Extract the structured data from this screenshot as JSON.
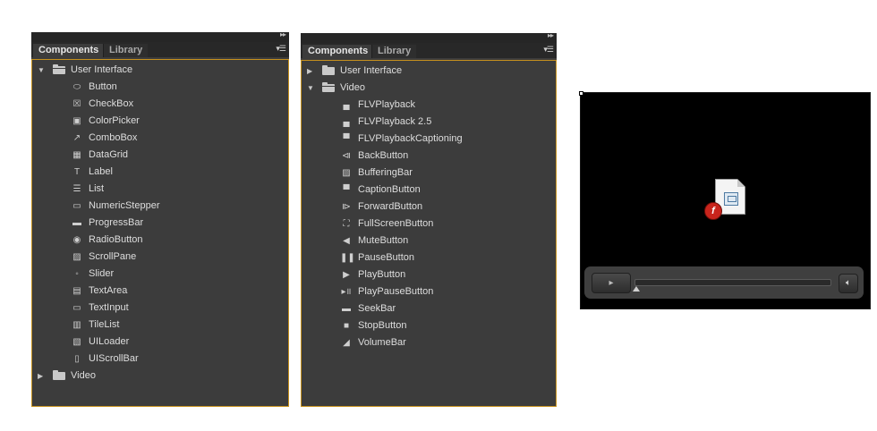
{
  "panel1": {
    "tabs": [
      "Components",
      "Library"
    ],
    "items": [
      {
        "kind": "folder",
        "open": true,
        "label": "User Interface"
      },
      {
        "kind": "item",
        "icon": "button-icon",
        "glyph": "⬭",
        "label": "Button"
      },
      {
        "kind": "item",
        "icon": "checkbox-icon",
        "glyph": "☒",
        "label": "CheckBox"
      },
      {
        "kind": "item",
        "icon": "colorpicker-icon",
        "glyph": "▣",
        "label": "ColorPicker"
      },
      {
        "kind": "item",
        "icon": "combobox-icon",
        "glyph": "↗",
        "label": "ComboBox"
      },
      {
        "kind": "item",
        "icon": "datagrid-icon",
        "glyph": "▦",
        "label": "DataGrid"
      },
      {
        "kind": "item",
        "icon": "label-icon",
        "glyph": "T",
        "label": "Label"
      },
      {
        "kind": "item",
        "icon": "list-icon",
        "glyph": "☰",
        "label": "List"
      },
      {
        "kind": "item",
        "icon": "numericstepper-icon",
        "glyph": "▭",
        "label": "NumericStepper"
      },
      {
        "kind": "item",
        "icon": "progressbar-icon",
        "glyph": "▬",
        "label": "ProgressBar"
      },
      {
        "kind": "item",
        "icon": "radiobutton-icon",
        "glyph": "◉",
        "label": "RadioButton"
      },
      {
        "kind": "item",
        "icon": "scrollpane-icon",
        "glyph": "▨",
        "label": "ScrollPane"
      },
      {
        "kind": "item",
        "icon": "slider-icon",
        "glyph": "◦",
        "label": "Slider"
      },
      {
        "kind": "item",
        "icon": "textarea-icon",
        "glyph": "▤",
        "label": "TextArea"
      },
      {
        "kind": "item",
        "icon": "textinput-icon",
        "glyph": "▭",
        "label": "TextInput"
      },
      {
        "kind": "item",
        "icon": "tilelist-icon",
        "glyph": "▥",
        "label": "TileList"
      },
      {
        "kind": "item",
        "icon": "uiloader-icon",
        "glyph": "▧",
        "label": "UILoader"
      },
      {
        "kind": "item",
        "icon": "uiscrollbar-icon",
        "glyph": "▯",
        "label": "UIScrollBar"
      },
      {
        "kind": "folder",
        "open": false,
        "label": "Video"
      }
    ]
  },
  "panel2": {
    "tabs": [
      "Components",
      "Library"
    ],
    "items": [
      {
        "kind": "folder",
        "open": false,
        "label": "User Interface"
      },
      {
        "kind": "folder",
        "open": true,
        "label": "Video"
      },
      {
        "kind": "item",
        "icon": "flvplayback-icon",
        "glyph": "▄",
        "label": "FLVPlayback"
      },
      {
        "kind": "item",
        "icon": "flvplayback25-icon",
        "glyph": "▄",
        "label": "FLVPlayback 2.5"
      },
      {
        "kind": "item",
        "icon": "flvplaybackcaptioning-icon",
        "glyph": "▀",
        "label": "FLVPlaybackCaptioning"
      },
      {
        "kind": "item",
        "icon": "backbutton-icon",
        "glyph": "⧏",
        "label": "BackButton"
      },
      {
        "kind": "item",
        "icon": "bufferingbar-icon",
        "glyph": "▨",
        "label": "BufferingBar"
      },
      {
        "kind": "item",
        "icon": "captionbutton-icon",
        "glyph": "▀",
        "label": "CaptionButton"
      },
      {
        "kind": "item",
        "icon": "forwardbutton-icon",
        "glyph": "⧐",
        "label": "ForwardButton"
      },
      {
        "kind": "item",
        "icon": "fullscreenbutton-icon",
        "glyph": "⛶",
        "label": "FullScreenButton"
      },
      {
        "kind": "item",
        "icon": "mutebutton-icon",
        "glyph": "◀",
        "label": "MuteButton"
      },
      {
        "kind": "item",
        "icon": "pausebutton-icon",
        "glyph": "❚❚",
        "label": "PauseButton"
      },
      {
        "kind": "item",
        "icon": "playbutton-icon",
        "glyph": "▶",
        "label": "PlayButton"
      },
      {
        "kind": "item",
        "icon": "playpausebutton-icon",
        "glyph": "▸॥",
        "label": "PlayPauseButton"
      },
      {
        "kind": "item",
        "icon": "seekbar-icon",
        "glyph": "▬",
        "label": "SeekBar"
      },
      {
        "kind": "item",
        "icon": "stopbutton-icon",
        "glyph": "■",
        "label": "StopButton"
      },
      {
        "kind": "item",
        "icon": "volumebar-icon",
        "glyph": "◢",
        "label": "VolumeBar"
      }
    ]
  },
  "player": {
    "play_glyph": "▸",
    "volume_glyph": "🔈︎",
    "flash_glyph": "f"
  },
  "colors": {
    "panel_bg": "#3c3c3c",
    "focus_border": "#c6911d",
    "text": "#dedede"
  }
}
